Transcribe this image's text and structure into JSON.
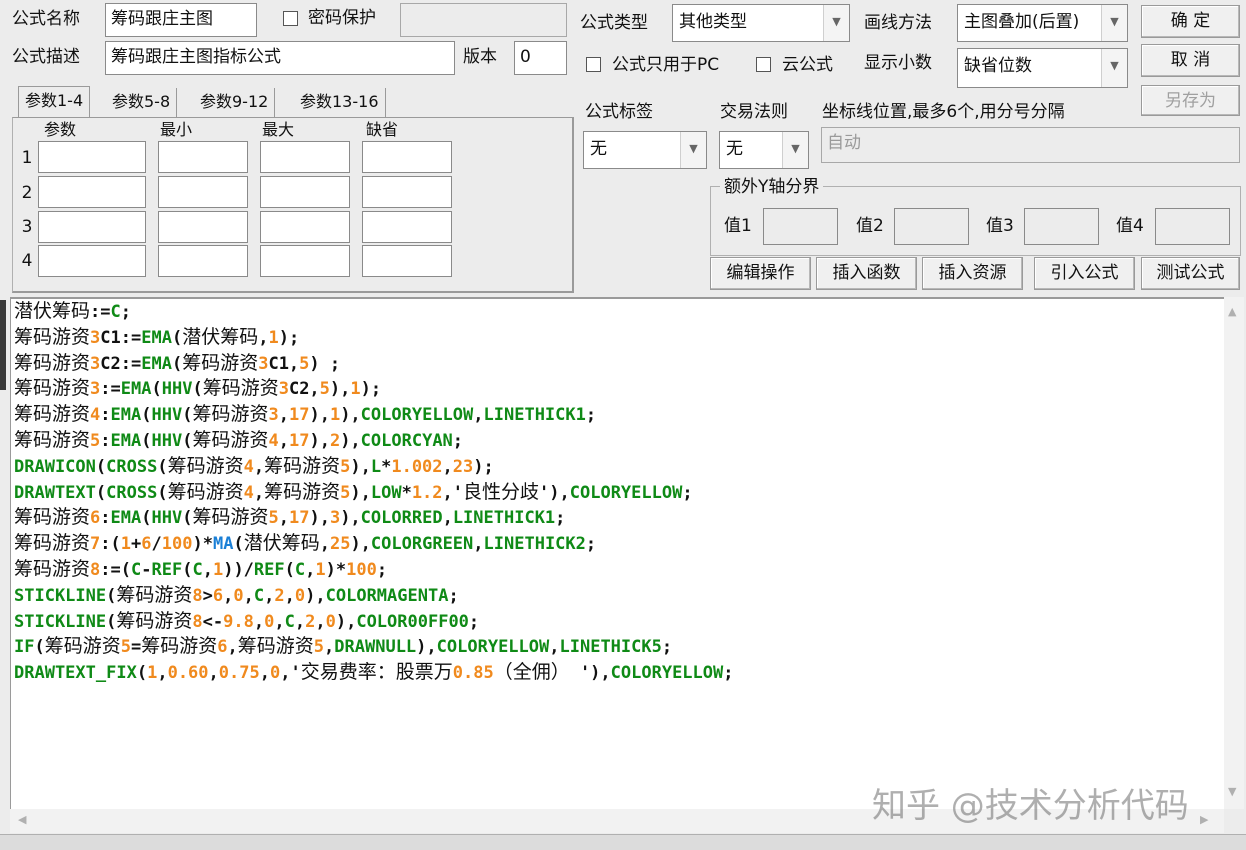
{
  "header": {
    "formula_name_label": "公式名称",
    "formula_name_value": "筹码跟庄主图",
    "password_protect_label": "密码保护",
    "formula_desc_label": "公式描述",
    "formula_desc_value": "筹码跟庄主图指标公式",
    "version_label": "版本",
    "version_value": "0",
    "formula_type_label": "公式类型",
    "formula_type_value": "其他类型",
    "draw_method_label": "画线方法",
    "draw_method_value": "主图叠加(后置)",
    "pc_only_label": "公式只用于PC",
    "cloud_label": "云公式",
    "decimals_label": "显示小数",
    "decimals_value": "缺省位数",
    "ok_button": "确 定",
    "cancel_button": "取 消",
    "save_as_button": "另存为"
  },
  "params": {
    "tabs": [
      "参数1-4",
      "参数5-8",
      "参数9-12",
      "参数13-16"
    ],
    "columns": [
      "参数",
      "最小",
      "最大",
      "缺省"
    ],
    "rows": [
      "1",
      "2",
      "3",
      "4"
    ]
  },
  "right": {
    "tag_label": "公式标签",
    "tag_value": "无",
    "rule_label": "交易法则",
    "rule_value": "无",
    "coord_label": "坐标线位置,最多6个,用分号分隔",
    "coord_value": "自动",
    "yaxis_group": "额外Y轴分界",
    "v1": "值1",
    "v2": "值2",
    "v3": "值3",
    "v4": "值4",
    "buttons": [
      "编辑操作",
      "插入函数",
      "插入资源",
      "引入公式",
      "测试公式"
    ]
  },
  "code": [
    "潜伏筹码:=C;",
    "筹码游资3C1:=EMA(潜伏筹码,1);",
    "筹码游资3C2:=EMA(筹码游资3C1,5) ;",
    "筹码游资3:=EMA(HHV(筹码游资3C2,5),1);",
    "筹码游资4:EMA(HHV(筹码游资3,17),1),COLORYELLOW,LINETHICK1;",
    "筹码游资5:EMA(HHV(筹码游资4,17),2),COLORCYAN;",
    "DRAWICON(CROSS(筹码游资4,筹码游资5),L*1.002,23);",
    "DRAWTEXT(CROSS(筹码游资4,筹码游资5),LOW*1.2,'良性分歧'),COLORYELLOW;",
    "筹码游资6:EMA(HHV(筹码游资5,17),3),COLORRED,LINETHICK1;",
    "筹码游资7:(1+6/100)*MA(潜伏筹码,25),COLORGREEN,LINETHICK2;",
    "筹码游资8:=(C-REF(C,1))/REF(C,1)*100;",
    "STICKLINE(筹码游资8>6,0,C,2,0),COLORMAGENTA;",
    "STICKLINE(筹码游资8<-9.8,0,C,2,0),COLOR00FF00;",
    "IF(筹码游资5=筹码游资6,筹码游资5,DRAWNULL),COLORYELLOW,LINETHICK5;",
    "DRAWTEXT_FIX(1,0.60,0.75,0,'交易费率：股票万0.85（全佣） '),COLORYELLOW;"
  ],
  "watermark": "知乎 @技术分析代码",
  "colors": {
    "function": "#0f8a16",
    "number": "#f08a1e",
    "ma": "#1a7fd6"
  }
}
